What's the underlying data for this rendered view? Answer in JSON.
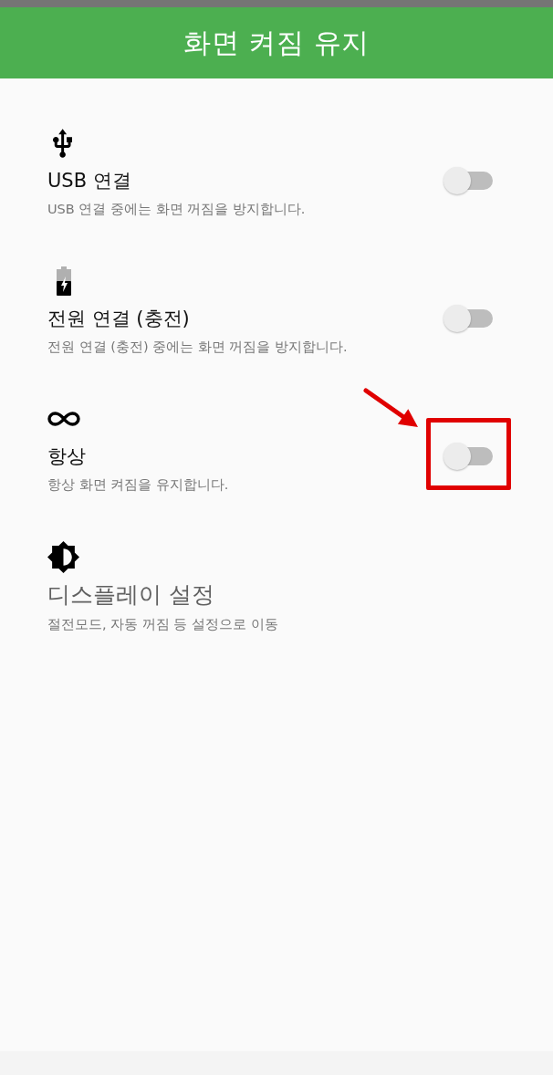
{
  "app_bar": {
    "title": "화면 켜짐 유지"
  },
  "settings": [
    {
      "kind": "toggle",
      "title": "USB 연결",
      "description": "USB 연결 중에는 화면 꺼짐을 방지합니다.",
      "on": false,
      "highlighted": false
    },
    {
      "kind": "toggle",
      "title": "전원 연결 (충전)",
      "description": "전원 연결 (충전) 중에는 화면 꺼짐을 방지합니다.",
      "on": false,
      "highlighted": false
    },
    {
      "kind": "toggle",
      "title": "항상",
      "description": "항상 화면 켜짐을 유지합니다.",
      "on": false,
      "highlighted": true
    },
    {
      "kind": "link",
      "title": "디스플레이 설정",
      "description": "절전모드, 자동 꺼짐 등 설정으로 이동"
    }
  ]
}
